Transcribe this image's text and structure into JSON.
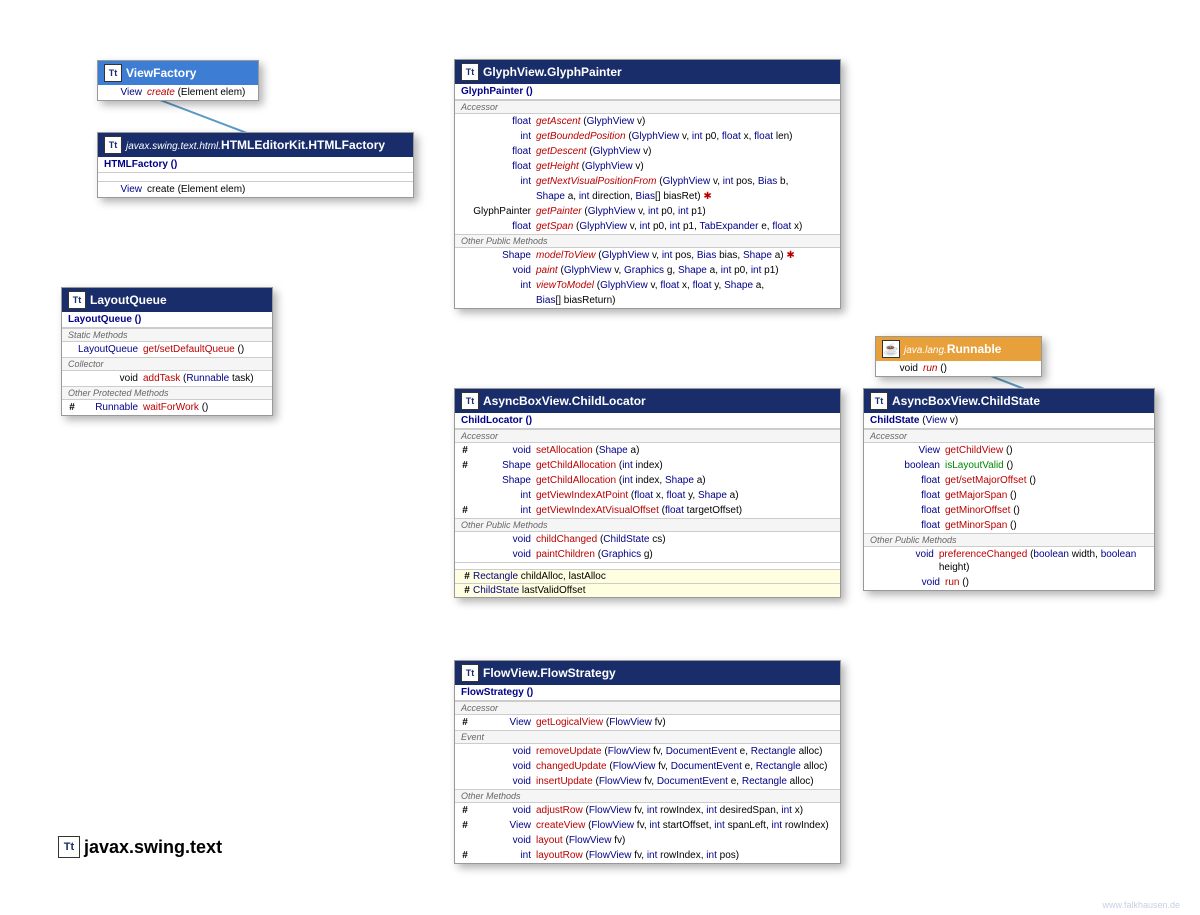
{
  "viewFactory": {
    "title": "ViewFactory",
    "method": {
      "ret": "View",
      "name": "create",
      "params": "(Element elem)"
    }
  },
  "htmlFactory": {
    "pkg": "javax.swing.text.html.",
    "title": "HTMLEditorKit.HTMLFactory",
    "ctor": "HTMLFactory ()",
    "method": {
      "ret": "View",
      "name": "create",
      "params": "(Element elem)"
    }
  },
  "layoutQueue": {
    "title": "LayoutQueue",
    "ctor": "LayoutQueue ()",
    "sections": {
      "static": "Static Methods",
      "collector": "Collector",
      "other": "Other Protected Methods"
    },
    "methods": {
      "defaultQueue": {
        "ret": "LayoutQueue",
        "name": "get/setDefaultQueue",
        "params": "()"
      },
      "addTask": {
        "ret": "void",
        "name": "addTask",
        "params": "(Runnable task)"
      },
      "waitForWork": {
        "mod": "#",
        "ret": "Runnable",
        "name": "waitForWork",
        "params": "()"
      }
    }
  },
  "glyphPainter": {
    "title": "GlyphView.GlyphPainter",
    "ctor": "GlyphPainter ()",
    "sections": {
      "accessor": "Accessor",
      "other": "Other Public Methods"
    },
    "methods": [
      {
        "ret": "float",
        "name": "getAscent",
        "params": "(GlyphView v)"
      },
      {
        "ret": "int",
        "name": "getBoundedPosition",
        "params": "(GlyphView v, int p0, float x, float len)"
      },
      {
        "ret": "float",
        "name": "getDescent",
        "params": "(GlyphView v)"
      },
      {
        "ret": "float",
        "name": "getHeight",
        "params": "(GlyphView v)"
      },
      {
        "ret": "int",
        "name": "getNextVisualPositionFrom",
        "params": "(GlyphView v, int pos, Bias b,"
      },
      {
        "ret": "",
        "name": "",
        "params": "Shape a, int direction, Bias[] biasRet) ✱"
      },
      {
        "ret": "GlyphPainter",
        "name": "getPainter",
        "params": "(GlyphView v, int p0, int p1)"
      },
      {
        "ret": "float",
        "name": "getSpan",
        "params": "(GlyphView v, int p0, int p1, TabExpander e, float x)"
      }
    ],
    "otherMethods": [
      {
        "ret": "Shape",
        "name": "modelToView",
        "params": "(GlyphView v, int pos, Bias bias, Shape a) ✱"
      },
      {
        "ret": "void",
        "name": "paint",
        "params": "(GlyphView v, Graphics g, Shape a, int p0, int p1)"
      },
      {
        "ret": "int",
        "name": "viewToModel",
        "params": "(GlyphView v, float x, float y, Shape a,"
      },
      {
        "ret": "",
        "name": "",
        "params": "Bias[] biasReturn)"
      }
    ]
  },
  "runnable": {
    "pkg": "java.lang.",
    "title": "Runnable",
    "method": {
      "ret": "void",
      "name": "run",
      "params": "()"
    }
  },
  "childLocator": {
    "title": "AsyncBoxView.ChildLocator",
    "ctor": "ChildLocator ()",
    "sections": {
      "accessor": "Accessor",
      "other": "Other Public Methods"
    },
    "methods": [
      {
        "mod": "#",
        "ret": "void",
        "name": "setAllocation",
        "params": "(Shape a)"
      },
      {
        "mod": "#",
        "ret": "Shape",
        "name": "getChildAllocation",
        "params": "(int index)"
      },
      {
        "mod": "",
        "ret": "Shape",
        "name": "getChildAllocation",
        "params": "(int index, Shape a)"
      },
      {
        "mod": "",
        "ret": "int",
        "name": "getViewIndexAtPoint",
        "params": "(float x, float y, Shape a)"
      },
      {
        "mod": "#",
        "ret": "int",
        "name": "getViewIndexAtVisualOffset",
        "params": "(float targetOffset)"
      }
    ],
    "otherMethods": [
      {
        "ret": "void",
        "name": "childChanged",
        "params": "(ChildState cs)"
      },
      {
        "ret": "void",
        "name": "paintChildren",
        "params": "(Graphics g)"
      }
    ],
    "fields": [
      {
        "mod": "#",
        "type": "Rectangle",
        "name": "childAlloc, lastAlloc"
      },
      {
        "mod": "#",
        "type": "ChildState",
        "name": "lastValidOffset"
      }
    ]
  },
  "childState": {
    "title": "AsyncBoxView.ChildState",
    "ctor": "ChildState",
    "ctorParams": "(View v)",
    "sections": {
      "accessor": "Accessor",
      "other": "Other Public Methods"
    },
    "methods": [
      {
        "ret": "View",
        "name": "getChildView",
        "params": "()"
      },
      {
        "ret": "boolean",
        "name": "isLayoutValid",
        "params": "()",
        "green": true
      },
      {
        "ret": "float",
        "name": "get/setMajorOffset",
        "params": "()"
      },
      {
        "ret": "float",
        "name": "getMajorSpan",
        "params": "()"
      },
      {
        "ret": "float",
        "name": "getMinorOffset",
        "params": "()"
      },
      {
        "ret": "float",
        "name": "getMinorSpan",
        "params": "()"
      }
    ],
    "otherMethods": [
      {
        "ret": "void",
        "name": "preferenceChanged",
        "params": "(boolean width, boolean height)"
      },
      {
        "ret": "void",
        "name": "run",
        "params": "()"
      }
    ]
  },
  "flowStrategy": {
    "title": "FlowView.FlowStrategy",
    "ctor": "FlowStrategy ()",
    "sections": {
      "accessor": "Accessor",
      "event": "Event",
      "other": "Other Methods"
    },
    "accessorMethods": [
      {
        "mod": "#",
        "ret": "View",
        "name": "getLogicalView",
        "params": "(FlowView fv)"
      }
    ],
    "eventMethods": [
      {
        "ret": "void",
        "name": "removeUpdate",
        "params": "(FlowView fv, DocumentEvent e, Rectangle alloc)"
      },
      {
        "ret": "void",
        "name": "changedUpdate",
        "params": "(FlowView fv, DocumentEvent e, Rectangle alloc)"
      },
      {
        "ret": "void",
        "name": "insertUpdate",
        "params": "(FlowView fv, DocumentEvent e, Rectangle alloc)"
      }
    ],
    "otherMethods": [
      {
        "mod": "#",
        "ret": "void",
        "name": "adjustRow",
        "params": "(FlowView fv, int rowIndex, int desiredSpan, int x)"
      },
      {
        "mod": "#",
        "ret": "View",
        "name": "createView",
        "params": "(FlowView fv, int startOffset, int spanLeft, int rowIndex)"
      },
      {
        "mod": "",
        "ret": "void",
        "name": "layout",
        "params": "(FlowView fv)"
      },
      {
        "mod": "#",
        "ret": "int",
        "name": "layoutRow",
        "params": "(FlowView fv, int rowIndex, int pos)"
      }
    ]
  },
  "pkgLabel": "javax.swing.text",
  "watermark": "www.falkhausen.de"
}
